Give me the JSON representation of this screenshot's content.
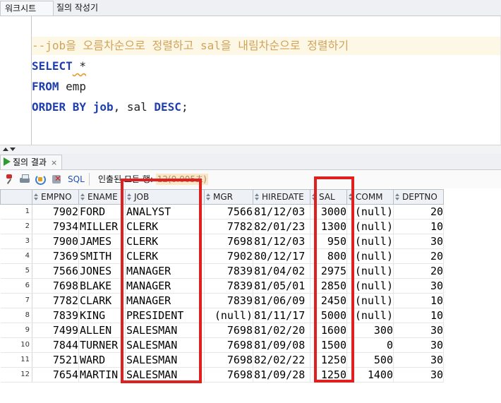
{
  "tabs": [
    {
      "label": "워크시트",
      "active": true
    },
    {
      "label": "질의 작성기",
      "active": false
    }
  ],
  "editor": {
    "comment": "--job을 오름차순으로 정렬하고 sal을 내림차순으로 정렬하기",
    "line2_kw": "SELECT",
    "line2_rest": " *",
    "line3_kw": "FROM",
    "line3_rest": " emp",
    "line4_kw1": "ORDER BY",
    "line4_kw2": "job",
    "line4_mid": ", sal ",
    "line4_kw3": "DESC",
    "line4_end": ";"
  },
  "results": {
    "tab_label": "질의 결과",
    "tab_close": "×",
    "sql_label": "SQL",
    "status_text": "인출된 모든 행: ",
    "status_blurred": "12(0.005초)"
  },
  "columns": [
    "EMPNO",
    "ENAME",
    "JOB",
    "MGR",
    "HIREDATE",
    "SAL",
    "COMM",
    "DEPTNO"
  ],
  "rows": [
    [
      "1",
      "7902",
      "FORD",
      "ANALYST",
      "7566",
      "81/12/03",
      "3000",
      "(null)",
      "20"
    ],
    [
      "2",
      "7934",
      "MILLER",
      "CLERK",
      "7782",
      "82/01/23",
      "1300",
      "(null)",
      "10"
    ],
    [
      "3",
      "7900",
      "JAMES",
      "CLERK",
      "7698",
      "81/12/03",
      "950",
      "(null)",
      "30"
    ],
    [
      "4",
      "7369",
      "SMITH",
      "CLERK",
      "7902",
      "80/12/17",
      "800",
      "(null)",
      "20"
    ],
    [
      "5",
      "7566",
      "JONES",
      "MANAGER",
      "7839",
      "81/04/02",
      "2975",
      "(null)",
      "20"
    ],
    [
      "6",
      "7698",
      "BLAKE",
      "MANAGER",
      "7839",
      "81/05/01",
      "2850",
      "(null)",
      "30"
    ],
    [
      "7",
      "7782",
      "CLARK",
      "MANAGER",
      "7839",
      "81/06/09",
      "2450",
      "(null)",
      "10"
    ],
    [
      "8",
      "7839",
      "KING",
      "PRESIDENT",
      "(null)",
      "81/11/17",
      "5000",
      "(null)",
      "10"
    ],
    [
      "9",
      "7499",
      "ALLEN",
      "SALESMAN",
      "7698",
      "81/02/20",
      "1600",
      "300",
      "30"
    ],
    [
      "10",
      "7844",
      "TURNER",
      "SALESMAN",
      "7698",
      "81/09/08",
      "1500",
      "0",
      "30"
    ],
    [
      "11",
      "7521",
      "WARD",
      "SALESMAN",
      "7698",
      "82/02/22",
      "1250",
      "500",
      "30"
    ],
    [
      "12",
      "7654",
      "MARTIN",
      "SALESMAN",
      "7698",
      "81/09/28",
      "1250",
      "1400",
      "30"
    ]
  ],
  "highlight_color": "#e0201f"
}
